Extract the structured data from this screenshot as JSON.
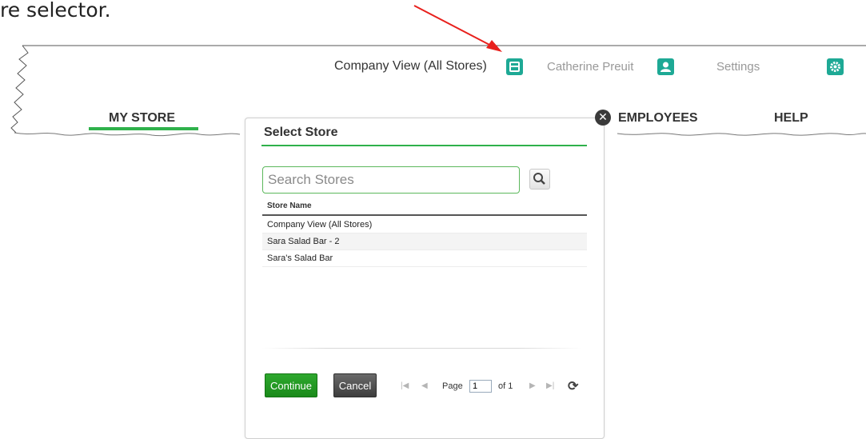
{
  "caption": "re selector.",
  "topbar": {
    "company_view": "Company View (All Stores)",
    "user_name": "Catherine Preuit",
    "settings": "Settings",
    "accent_color": "#1ea995"
  },
  "nav": {
    "tabs": [
      {
        "label": "MY STORE",
        "active": true
      },
      {
        "label": "EMPLOYEES",
        "active": false
      },
      {
        "label": "HELP",
        "active": false
      }
    ]
  },
  "modal": {
    "title": "Select Store",
    "search": {
      "placeholder": "Search Stores",
      "value": ""
    },
    "table": {
      "header": "Store Name",
      "rows": [
        "Company View (All Stores)",
        "Sara Salad Bar - 2",
        "Sara's Salad Bar"
      ]
    },
    "buttons": {
      "continue": "Continue",
      "cancel": "Cancel"
    },
    "pager": {
      "page_label": "Page",
      "page_value": "1",
      "of_label": "of 1"
    }
  },
  "colors": {
    "green": "#2fb14b",
    "annotation_arrow": "#e8201c"
  }
}
